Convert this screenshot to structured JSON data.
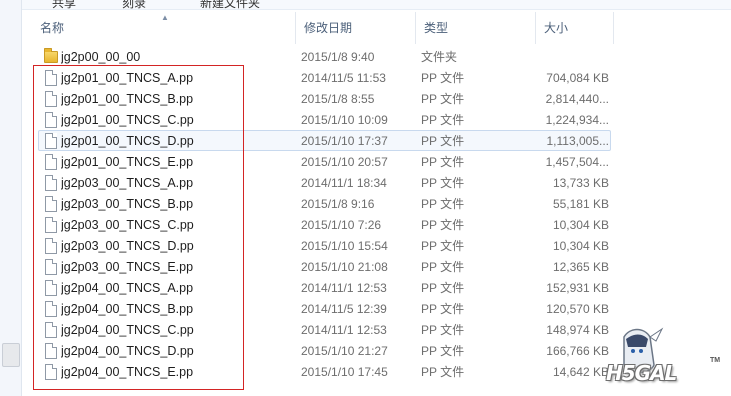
{
  "toolbar": {
    "share_label": "共享",
    "burn_label": "刻录",
    "new_folder_label": "新建文件夹"
  },
  "columns": {
    "name": "名称",
    "date": "修改日期",
    "type": "类型",
    "size": "大小"
  },
  "files": [
    {
      "name": "jg2p00_00_00",
      "date": "2015/1/8 9:40",
      "type": "文件夹",
      "size": "",
      "kind": "folder"
    },
    {
      "name": "jg2p01_00_TNCS_A.pp",
      "date": "2014/11/5 11:53",
      "type": "PP 文件",
      "size": "704,084 KB",
      "kind": "file"
    },
    {
      "name": "jg2p01_00_TNCS_B.pp",
      "date": "2015/1/8 8:55",
      "type": "PP 文件",
      "size": "2,814,440...",
      "kind": "file"
    },
    {
      "name": "jg2p01_00_TNCS_C.pp",
      "date": "2015/1/10 10:09",
      "type": "PP 文件",
      "size": "1,224,934...",
      "kind": "file"
    },
    {
      "name": "jg2p01_00_TNCS_D.pp",
      "date": "2015/1/10 17:37",
      "type": "PP 文件",
      "size": "1,113,005...",
      "kind": "file",
      "selected": true
    },
    {
      "name": "jg2p01_00_TNCS_E.pp",
      "date": "2015/1/10 20:57",
      "type": "PP 文件",
      "size": "1,457,504...",
      "kind": "file"
    },
    {
      "name": "jg2p03_00_TNCS_A.pp",
      "date": "2014/11/1 18:34",
      "type": "PP 文件",
      "size": "13,733 KB",
      "kind": "file"
    },
    {
      "name": "jg2p03_00_TNCS_B.pp",
      "date": "2015/1/8 9:16",
      "type": "PP 文件",
      "size": "55,181 KB",
      "kind": "file"
    },
    {
      "name": "jg2p03_00_TNCS_C.pp",
      "date": "2015/1/10 7:26",
      "type": "PP 文件",
      "size": "10,304 KB",
      "kind": "file"
    },
    {
      "name": "jg2p03_00_TNCS_D.pp",
      "date": "2015/1/10 15:54",
      "type": "PP 文件",
      "size": "10,304 KB",
      "kind": "file"
    },
    {
      "name": "jg2p03_00_TNCS_E.pp",
      "date": "2015/1/10 21:08",
      "type": "PP 文件",
      "size": "12,365 KB",
      "kind": "file"
    },
    {
      "name": "jg2p04_00_TNCS_A.pp",
      "date": "2014/11/1 12:53",
      "type": "PP 文件",
      "size": "152,931 KB",
      "kind": "file"
    },
    {
      "name": "jg2p04_00_TNCS_B.pp",
      "date": "2014/11/5 12:39",
      "type": "PP 文件",
      "size": "120,570 KB",
      "kind": "file"
    },
    {
      "name": "jg2p04_00_TNCS_C.pp",
      "date": "2014/11/1 12:53",
      "type": "PP 文件",
      "size": "148,974 KB",
      "kind": "file"
    },
    {
      "name": "jg2p04_00_TNCS_D.pp",
      "date": "2015/1/10 21:27",
      "type": "PP 文件",
      "size": "166,766 KB",
      "kind": "file"
    },
    {
      "name": "jg2p04_00_TNCS_E.pp",
      "date": "2015/1/10 17:45",
      "type": "PP 文件",
      "size": "14,642 KB",
      "kind": "file"
    }
  ],
  "watermark": {
    "text": "H5GAL",
    "tm": "TM"
  },
  "colors": {
    "highlight_box": "#d32424",
    "selected_row_bg": "#f4f8fd",
    "selected_row_border": "#c8d9ee",
    "header_text": "#4c607a"
  },
  "icons": {
    "folder": "folder-icon",
    "file": "file-icon",
    "sort": "sort-up-arrow-icon"
  }
}
